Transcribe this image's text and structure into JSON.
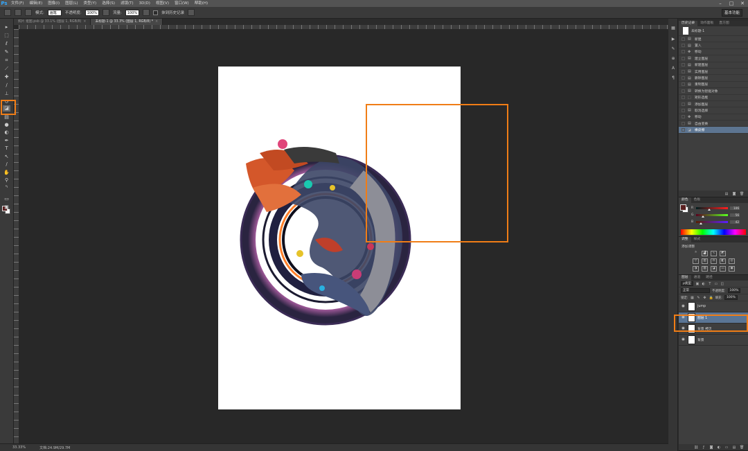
{
  "app": {
    "logo": "Ps"
  },
  "menu": [
    "文件(F)",
    "编辑(E)",
    "图像(I)",
    "图层(L)",
    "类型(Y)",
    "选择(S)",
    "滤镜(T)",
    "3D(D)",
    "视图(V)",
    "窗口(W)",
    "帮助(H)"
  ],
  "window_controls": [
    "–",
    "□",
    "✕"
  ],
  "options": {
    "mode_label": "模式:",
    "mode_value": "画笔",
    "opacity_label": "不透明度:",
    "opacity_value": "100%",
    "flow_label": "流量:",
    "flow_value": "100%",
    "erase_history": "抹到历史记录",
    "workspace": "基本功能"
  },
  "tabs": [
    {
      "label": "照片 抠图.psb @ 33.1% (图层 1, RGB/8)",
      "close": "×"
    },
    {
      "label": "未标题-1 @ 33.3% (图层 1, RGB/8) *",
      "close": "×"
    }
  ],
  "status": {
    "zoom": "33.33%",
    "doc": "文档:24.9M/29.7M"
  },
  "history": {
    "snapshot": "未标题-1",
    "items": [
      {
        "label": "新建",
        "icon": "doc-icon"
      },
      {
        "label": "置入",
        "icon": "doc-icon"
      },
      {
        "label": "移动",
        "icon": "move-icon"
      },
      {
        "label": "建立图层",
        "icon": "doc-icon"
      },
      {
        "label": "新建图层",
        "icon": "doc-icon"
      },
      {
        "label": "实用图层",
        "icon": "doc-icon"
      },
      {
        "label": "删除图层",
        "icon": "doc-icon"
      },
      {
        "label": "重制图层",
        "icon": "doc-icon"
      },
      {
        "label": "转换为智能对象",
        "icon": "doc-icon"
      },
      {
        "label": "矩形选框",
        "icon": "marquee-icon"
      },
      {
        "label": "添加图层",
        "icon": "doc-icon"
      },
      {
        "label": "取消选择",
        "icon": "doc-icon"
      },
      {
        "label": "移动",
        "icon": "move-icon"
      },
      {
        "label": "自由变换",
        "icon": "doc-icon"
      },
      {
        "label": "橡皮擦",
        "icon": "eraser-icon"
      }
    ],
    "active_index": 14
  },
  "panel_tabs": {
    "history": [
      "历史记录",
      "动作面板",
      "直方图"
    ],
    "color": [
      "颜色",
      "色板"
    ],
    "adjust": [
      "调整",
      "样式"
    ],
    "layers": [
      "图层",
      "通道",
      "路径"
    ]
  },
  "color": {
    "fg": "#5a1f1f",
    "bg": "#ffffff",
    "r": {
      "label": "R",
      "value": "106",
      "pct": 0.42
    },
    "g": {
      "label": "G",
      "value": "56",
      "pct": 0.22
    },
    "b": {
      "label": "B",
      "value": "42",
      "pct": 0.16
    }
  },
  "adjust": {
    "title": "添加调整"
  },
  "layers": {
    "filter": "ρ类型",
    "blend": "正常",
    "opacity_label": "不透明度:",
    "opacity": "100%",
    "lock_label": "锁定:",
    "fill_label": "填充:",
    "fill": "100%",
    "items": [
      {
        "name": "jump",
        "active": false
      },
      {
        "name": "图层 1",
        "active": true
      },
      {
        "name": "背景 拷贝",
        "active": false
      },
      {
        "name": "背景",
        "active": false
      }
    ]
  },
  "accent": "#f07d16"
}
